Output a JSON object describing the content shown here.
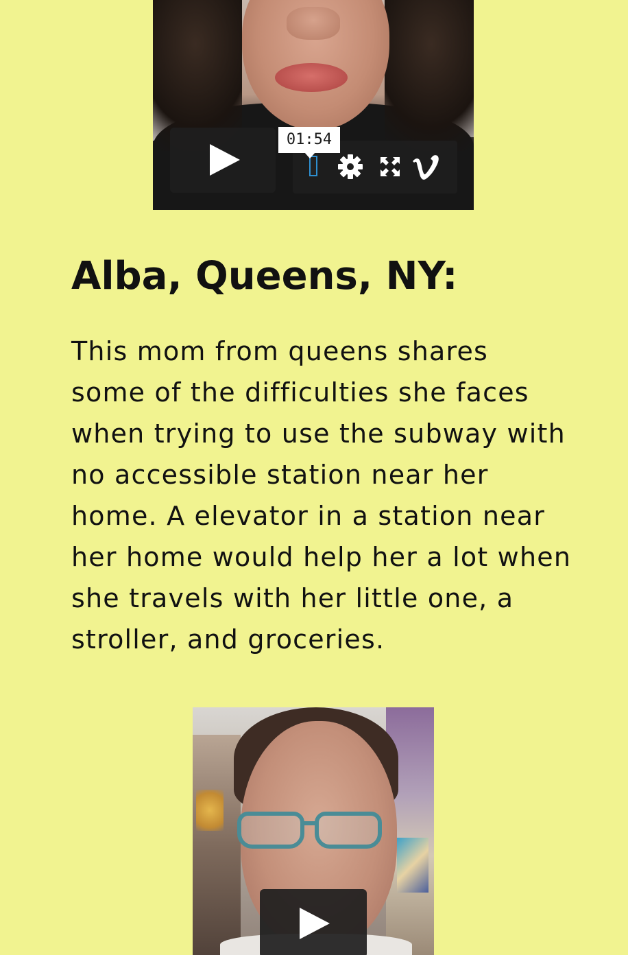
{
  "video1": {
    "tooltip_time": "01:54",
    "controls": [
      "play-icon",
      "progress-marker",
      "gear-icon",
      "fullscreen-icon",
      "vimeo-icon"
    ]
  },
  "section": {
    "heading": "Alba, Queens, NY:",
    "paragraph_lines": [
      "This mom from queens shares",
      "some of the difficulties she faces",
      "when trying to use the subway with",
      "no accessible station near her",
      "home. A elevator in a station near",
      "her home would help her a lot when",
      "she travels with her little one, a",
      "stroller, and groceries."
    ]
  },
  "video2": {
    "controls": [
      "play-icon"
    ]
  },
  "colors": {
    "page_background": "#f1f390",
    "control_background": "#1e1e1e",
    "progress_accent": "#2e8fd0",
    "text": "#111111"
  }
}
